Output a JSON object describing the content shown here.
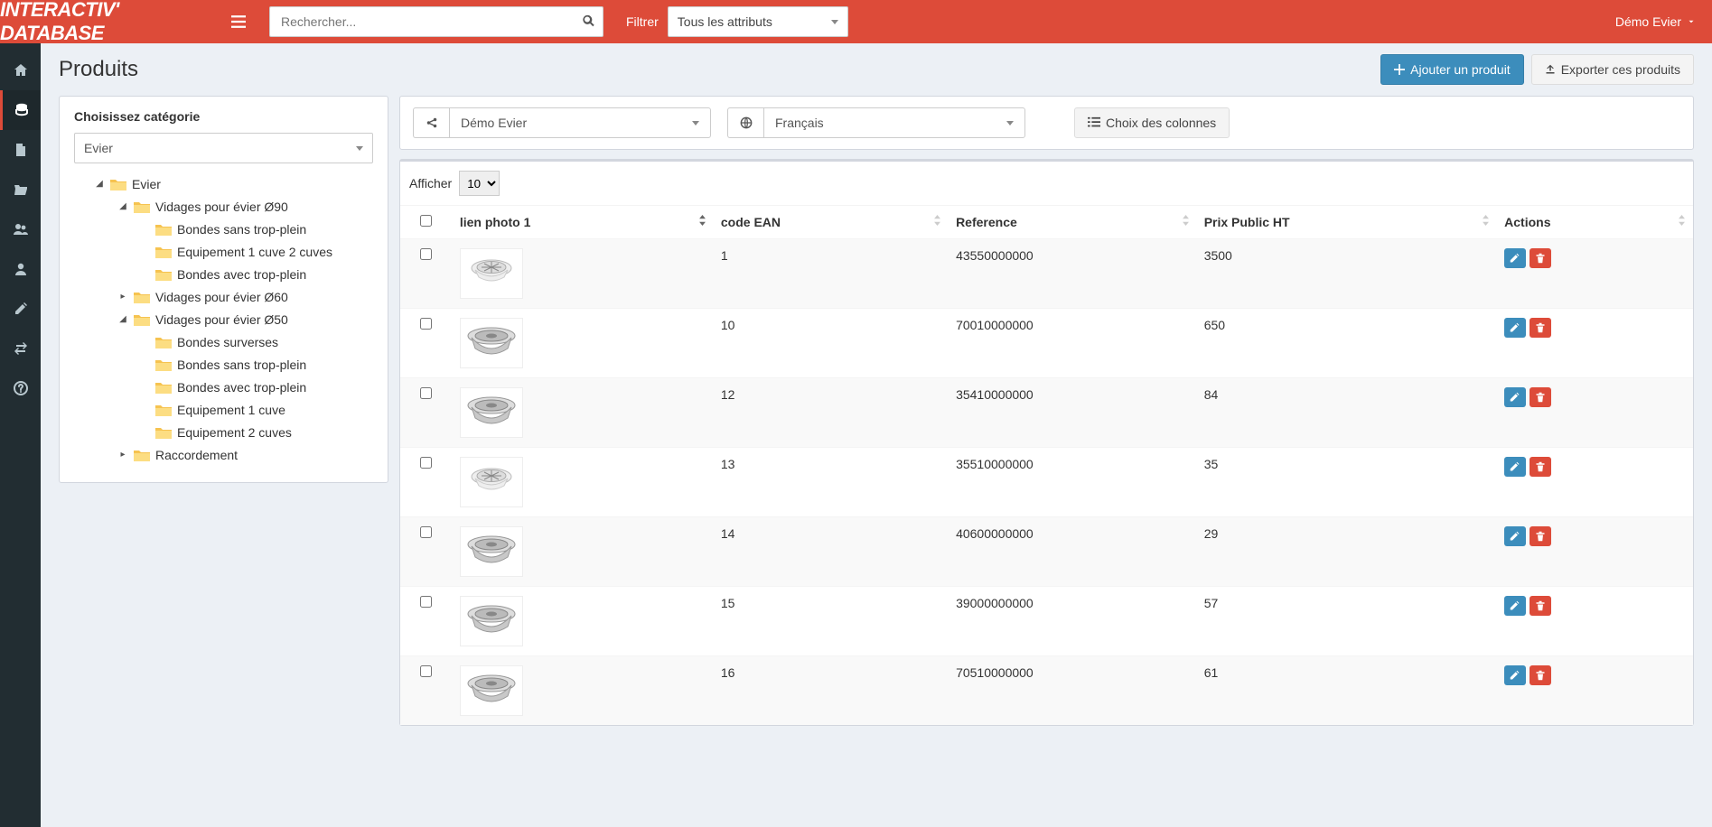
{
  "header": {
    "logo": "INTERACTIV' DATABASE",
    "search_placeholder": "Rechercher...",
    "filter_label": "Filtrer",
    "filter_select": "Tous les attributs",
    "user": "Démo Evier"
  },
  "page": {
    "title": "Produits",
    "add_btn": "Ajouter un produit",
    "export_btn": "Exporter ces produits"
  },
  "category": {
    "panel_title": "Choisissez catégorie",
    "select": "Evier",
    "tree": [
      {
        "lvl": 0,
        "exp": "open",
        "label": "Evier"
      },
      {
        "lvl": 1,
        "exp": "open",
        "label": "Vidages pour évier Ø90"
      },
      {
        "lvl": 2,
        "exp": "none",
        "label": "Bondes sans trop-plein"
      },
      {
        "lvl": 2,
        "exp": "none",
        "label": "Equipement 1 cuve 2 cuves"
      },
      {
        "lvl": 2,
        "exp": "none",
        "label": "Bondes avec trop-plein"
      },
      {
        "lvl": 1,
        "exp": "closed",
        "label": "Vidages pour évier Ø60"
      },
      {
        "lvl": 1,
        "exp": "open",
        "label": "Vidages pour évier Ø50"
      },
      {
        "lvl": 2,
        "exp": "none",
        "label": "Bondes surverses"
      },
      {
        "lvl": 2,
        "exp": "none",
        "label": "Bondes sans trop-plein"
      },
      {
        "lvl": 2,
        "exp": "none",
        "label": "Bondes avec trop-plein"
      },
      {
        "lvl": 2,
        "exp": "none",
        "label": "Equipement 1 cuve"
      },
      {
        "lvl": 2,
        "exp": "none",
        "label": "Equipement 2 cuves"
      },
      {
        "lvl": 1,
        "exp": "closed",
        "label": "Raccordement"
      }
    ]
  },
  "toolbar": {
    "share_select": "Démo Evier",
    "lang_select": "Français",
    "columns_btn": "Choix des colonnes"
  },
  "table": {
    "show_label": "Afficher",
    "show_value": "10",
    "columns": {
      "photo": "lien photo 1",
      "ean": "code EAN",
      "ref": "Reference",
      "prix": "Prix Public HT",
      "actions": "Actions"
    },
    "rows": [
      {
        "ean": "1",
        "ref": "43550000000",
        "prix": "3500",
        "kind": "grate"
      },
      {
        "ean": "10",
        "ref": "70010000000",
        "prix": "650",
        "kind": "basket"
      },
      {
        "ean": "12",
        "ref": "35410000000",
        "prix": "84",
        "kind": "basket"
      },
      {
        "ean": "13",
        "ref": "35510000000",
        "prix": "35",
        "kind": "grate"
      },
      {
        "ean": "14",
        "ref": "40600000000",
        "prix": "29",
        "kind": "basket"
      },
      {
        "ean": "15",
        "ref": "39000000000",
        "prix": "57",
        "kind": "basket"
      },
      {
        "ean": "16",
        "ref": "70510000000",
        "prix": "61",
        "kind": "basket"
      }
    ]
  }
}
